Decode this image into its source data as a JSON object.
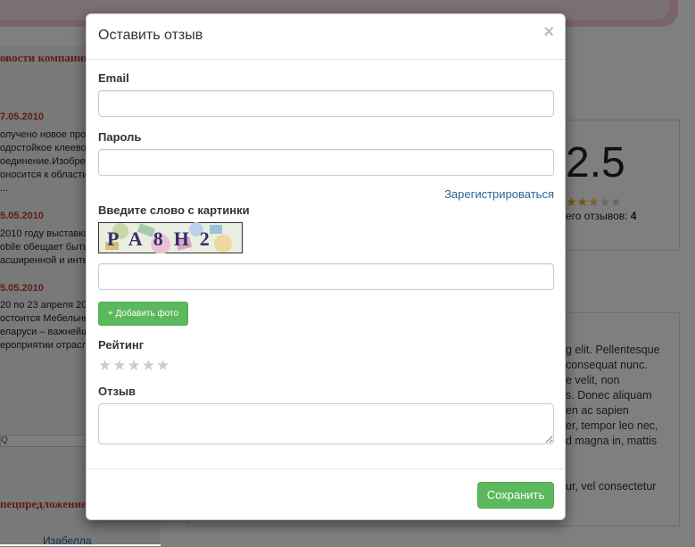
{
  "background": {
    "left_title": "овости компании",
    "news": [
      {
        "date": "7.05.2010",
        "lines": [
          "олучено новое проч",
          "одостойкое клеевое",
          "оединение.Изобрете",
          "оносится к области п",
          "..."
        ]
      },
      {
        "date": "5.05.2010",
        "lines": [
          "2010 году выставка",
          "obile обещает быть",
          "асширенной и интер"
        ]
      },
      {
        "date": "5.05.2010",
        "lines": [
          "20 по 23 апреля 20",
          "остоится Мебельны",
          "еларуси – важнейш",
          "ероприятии отрасл"
        ]
      }
    ],
    "search_glyph": "Q",
    "left_title2": "пецпредложение",
    "link": "Изабелла",
    "rating_value": "2.5",
    "rating_count_text": "его отзывов: ",
    "rating_count": "4",
    "review_lines": [
      "g elit. Pellentesque",
      "consequat nunc.",
      "e velit, non",
      "s. Donec aliquam",
      "en ac sapien",
      "er, tempor leo nec,",
      "d magna in, mattis",
      "",
      "",
      "ur, vel consectetur"
    ]
  },
  "modal": {
    "title": "Оставить отзыв",
    "close_symbol": "×",
    "email_label": "Email",
    "email_value": "",
    "password_label": "Пароль",
    "password_value": "",
    "register_link": "Зарегистрироваться",
    "captcha_label": "Введите слово с картинки",
    "captcha_text": "PA8H2",
    "captcha_value": "",
    "add_photo_button": "+ Добавить фото",
    "rating_label": "Рейтинг",
    "rating_stars": [
      "★",
      "★",
      "★",
      "★",
      "★"
    ],
    "rating_value": 0,
    "review_label": "Отзыв",
    "review_value": "",
    "save_button": "Сохранить"
  },
  "colors": {
    "accent_green": "#5cb85c",
    "link_blue": "#2a6496",
    "star_gold": "#f0ad1e",
    "star_empty": "#cccccc",
    "brand_red": "#c0392b"
  }
}
